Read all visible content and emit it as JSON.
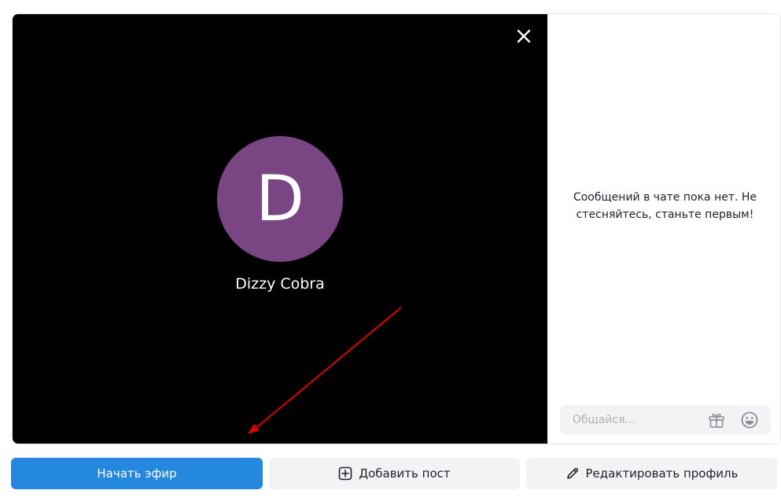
{
  "stream": {
    "close_icon": "close-icon",
    "avatar_letter": "D",
    "avatar_color": "#7a4583",
    "user_name": "Dizzy Cobra"
  },
  "chat": {
    "empty_message": "Сообщений в чате пока нет. Не стесняйтесь, станьте первым!",
    "input_placeholder": "Общайся...",
    "gift_icon": "gift-icon",
    "emoji_icon": "emoji-icon"
  },
  "actions": {
    "start_label": "Начать эфир",
    "add_post_label": "Добавить пост",
    "add_post_icon": "plus-square-icon",
    "edit_profile_label": "Редактировать профиль",
    "edit_profile_icon": "pencil-icon"
  },
  "annotation": {
    "arrow_color": "#e00000"
  },
  "colors": {
    "primary": "#2388de",
    "secondary_bg": "#f2f3f5",
    "video_bg": "#000000"
  }
}
